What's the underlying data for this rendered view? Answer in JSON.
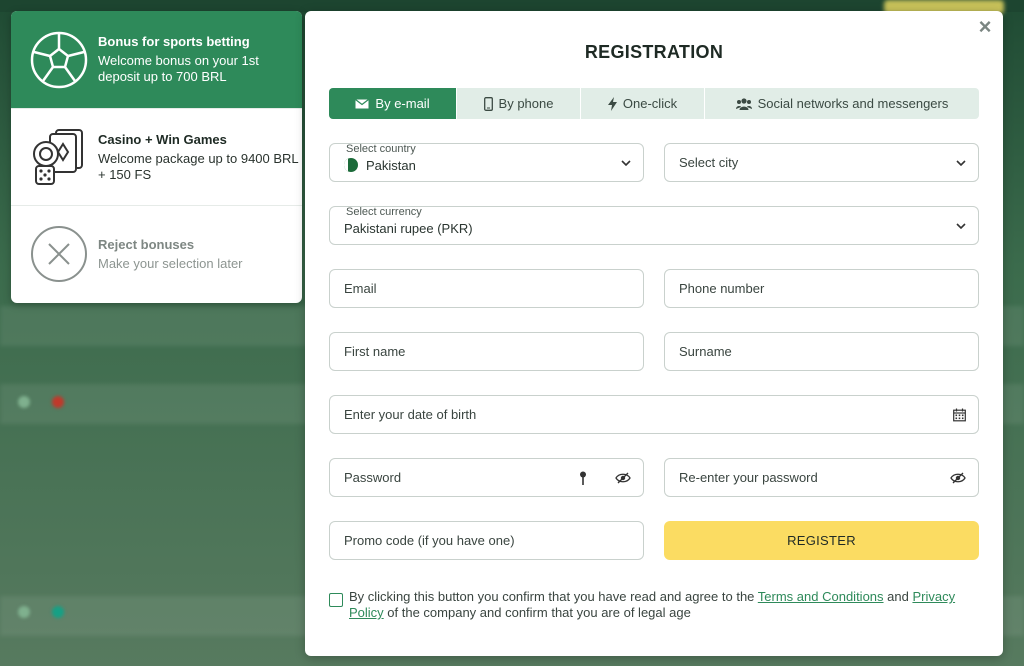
{
  "bonuses": [
    {
      "title": "Bonus for sports betting",
      "desc": "Welcome bonus on your 1st deposit up to 700 BRL",
      "icon": "soccer-ball-icon"
    },
    {
      "title": "Casino + Win Games",
      "desc": "Welcome package up to 9400 BRL + 150 FS",
      "icon": "casino-chips-cards-icon"
    },
    {
      "title": "Reject bonuses",
      "desc": "Make your selection later",
      "icon": "x-circle-icon"
    }
  ],
  "modal": {
    "title": "REGISTRATION",
    "close": "×",
    "tabs": [
      {
        "label": "By e-mail",
        "icon": "envelope-icon"
      },
      {
        "label": "By phone",
        "icon": "phone-icon"
      },
      {
        "label": "One-click",
        "icon": "lightning-icon"
      },
      {
        "label": "Social networks and messengers",
        "icon": "users-icon"
      }
    ],
    "country": {
      "label": "Select country",
      "value": "Pakistan"
    },
    "city": {
      "placeholder": "Select city"
    },
    "currency": {
      "label": "Select currency",
      "value": "Pakistani rupee (PKR)"
    },
    "email": {
      "placeholder": "Email"
    },
    "phone": {
      "placeholder": "Phone number"
    },
    "first_name": {
      "placeholder": "First name"
    },
    "surname": {
      "placeholder": "Surname"
    },
    "dob": {
      "placeholder": "Enter your date of birth"
    },
    "password": {
      "placeholder": "Password"
    },
    "repassword": {
      "placeholder": "Re-enter your password"
    },
    "promo": {
      "placeholder": "Promo code (if you have one)"
    },
    "register_label": "REGISTER",
    "agree": {
      "text1": "By clicking this button you confirm that you have read and agree to the ",
      "terms": "Terms and Conditions",
      "text2": " and ",
      "privacy": "Privacy Policy",
      "text3": " of the company and confirm that you are of legal age"
    }
  },
  "colors": {
    "accent": "#2e8a5a",
    "register": "#fbdc62"
  }
}
